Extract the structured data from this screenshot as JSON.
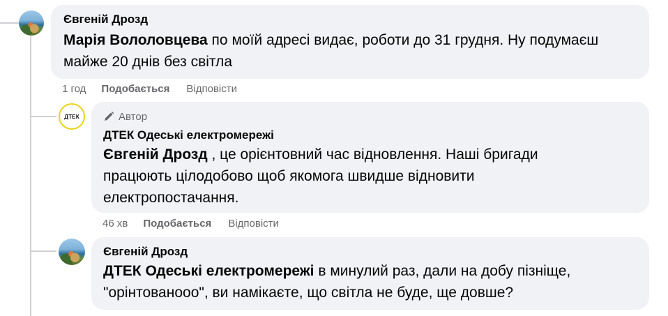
{
  "comments": [
    {
      "author": "Євгеній Дрозд",
      "mention": "Марія Вололовцева",
      "text": " по моїй адресі видає, роботи до 31 грудня. Ну подумаєш майже 20 днів без світла",
      "time": "1 год",
      "like_label": "Подобається",
      "reply_label": "Відповісти"
    },
    {
      "badge_icon": "pencil-icon",
      "badge_label": "Автор",
      "author": "ДТЕК Одеські електромережі",
      "avatar_text": "ДТЕК",
      "mention": "Євгеній Дрозд",
      "text": " , це орієнтовний час відновлення. Наші бригади працюють цілодобово щоб якомога швидше відновити електропостачання.",
      "time": "46 хв",
      "like_label": "Подобається",
      "reply_label": "Відповісти"
    },
    {
      "author": "Євгеній Дрозд",
      "mention": "ДТЕК Одеські електромережі",
      "text": " в минулий раз, дали на добу пізніще, \"орінтованооо\", ви намікаєте, що світла не буде, ще довше?"
    }
  ],
  "colors": {
    "bubble": "#f0f2f5",
    "meta_text": "#65676b",
    "thread_line": "#ced0d4",
    "dtek_ring": "#e8d31a"
  }
}
